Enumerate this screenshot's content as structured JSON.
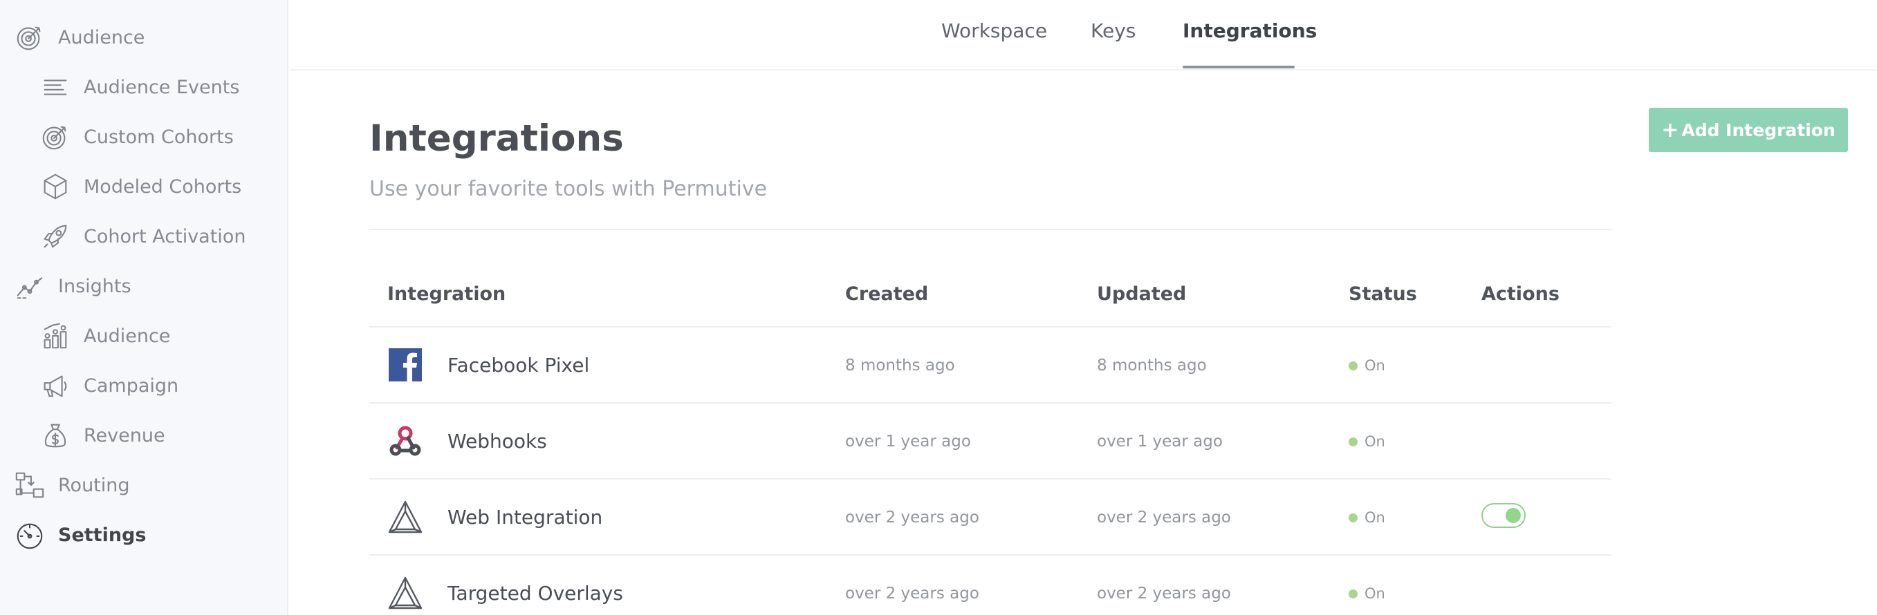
{
  "sidebar": {
    "items": [
      {
        "label": "Audience",
        "icon": "target-icon",
        "level": "top"
      },
      {
        "label": "Audience Events",
        "icon": "lines-icon",
        "level": "sub"
      },
      {
        "label": "Custom Cohorts",
        "icon": "target-icon",
        "level": "sub"
      },
      {
        "label": "Modeled Cohorts",
        "icon": "cube-icon",
        "level": "sub"
      },
      {
        "label": "Cohort Activation",
        "icon": "rocket-icon",
        "level": "sub"
      },
      {
        "label": "Insights",
        "icon": "trend-line-icon",
        "level": "top"
      },
      {
        "label": "Audience",
        "icon": "people-bars-icon",
        "level": "sub"
      },
      {
        "label": "Campaign",
        "icon": "megaphone-icon",
        "level": "sub"
      },
      {
        "label": "Revenue",
        "icon": "money-bag-icon",
        "level": "sub"
      },
      {
        "label": "Routing",
        "icon": "routing-icon",
        "level": "top"
      },
      {
        "label": "Settings",
        "icon": "gauge-icon",
        "level": "top",
        "active": true
      }
    ]
  },
  "tabs": [
    {
      "label": "Workspace"
    },
    {
      "label": "Keys"
    },
    {
      "label": "Integrations",
      "active": true
    }
  ],
  "header": {
    "title": "Integrations",
    "subtitle": "Use your favorite tools with Permutive",
    "add_button": {
      "plus": "+",
      "label": "Add Integration"
    }
  },
  "table": {
    "columns": [
      "Integration",
      "Created",
      "Updated",
      "Status",
      "Actions"
    ],
    "rows": [
      {
        "name": "Facebook Pixel",
        "icon": "facebook-icon",
        "created": "8 months ago",
        "updated": "8 months ago",
        "status": "On",
        "toggle": false
      },
      {
        "name": "Webhooks",
        "icon": "webhooks-icon",
        "created": "over 1 year ago",
        "updated": "over 1 year ago",
        "status": "On",
        "toggle": false
      },
      {
        "name": "Web Integration",
        "icon": "permutive-logo-icon",
        "created": "over 2 years ago",
        "updated": "over 2 years ago",
        "status": "On",
        "toggle": true
      },
      {
        "name": "Targeted Overlays",
        "icon": "permutive-logo-icon",
        "created": "over 2 years ago",
        "updated": "over 2 years ago",
        "status": "On",
        "toggle": false
      }
    ]
  },
  "colors": {
    "accent_button": "#8fd3b6",
    "status_on": "#a8d58b",
    "facebook_blue": "#3b5998",
    "webhooks_red": "#c73a63"
  }
}
